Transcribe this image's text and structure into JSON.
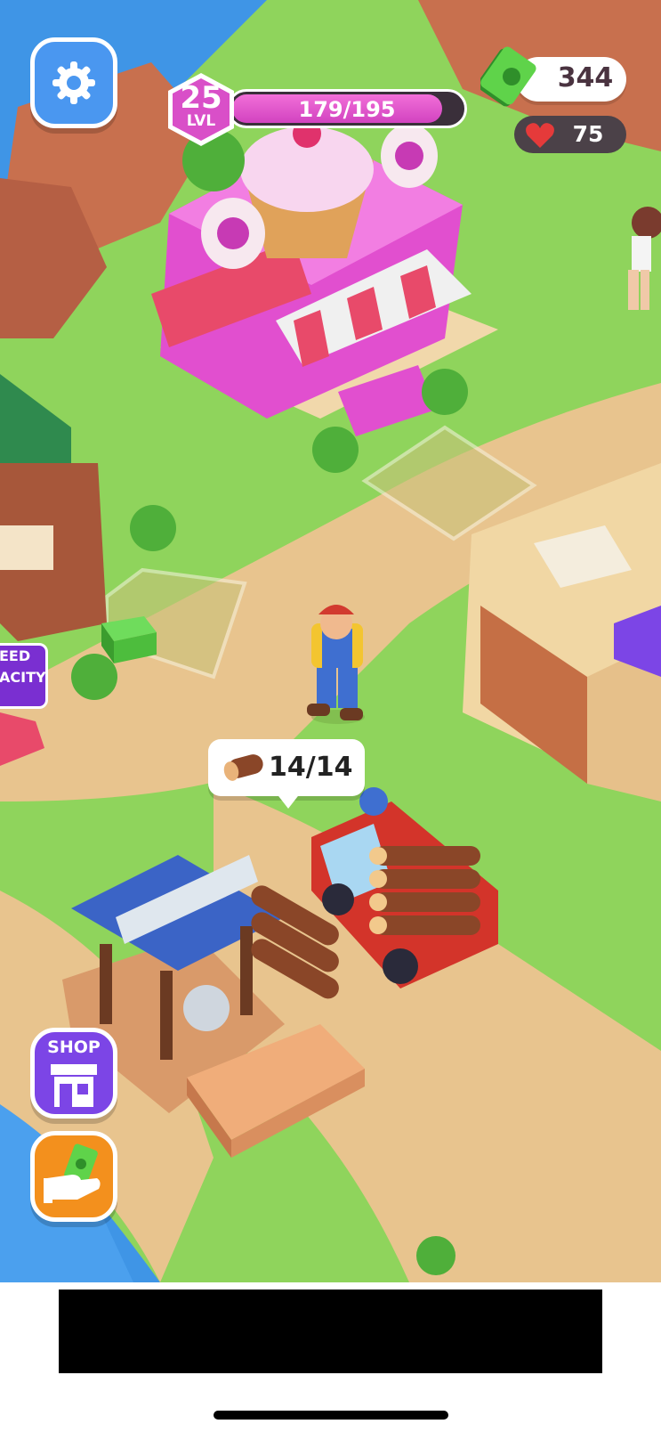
{
  "hud": {
    "level": "25",
    "level_label": "LVL",
    "xp_text": "179/195",
    "xp_progress": 0.918,
    "money": "344",
    "hearts": "75"
  },
  "side_tag": {
    "line1": "EED",
    "line2": "ACITY"
  },
  "log_bubble": {
    "count_text": "14/14"
  },
  "shop": {
    "label": "SHOP"
  },
  "colors": {
    "water": "#3f95e6",
    "grass": "#8fd45c",
    "path": "#e8c48e",
    "accent_purple": "#7c45e6",
    "accent_pink": "#e24fc8",
    "money_green": "#3dbb3a"
  },
  "icons": [
    "gear-icon",
    "cash-stack-icon",
    "heart-icon",
    "log-icon",
    "store-icon",
    "hand-cash-icon"
  ]
}
